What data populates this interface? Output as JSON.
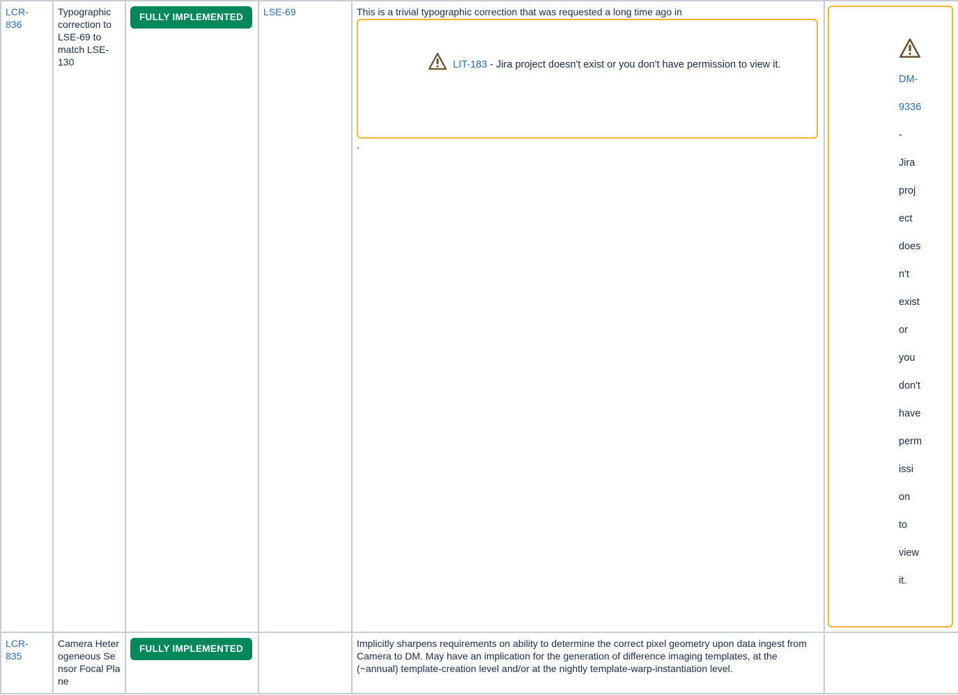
{
  "rows": [
    {
      "id": "LCR-836",
      "id_line1": "LCR-",
      "id_line2": "836",
      "title": "Typographic correction to LSE-69 to match LSE-130",
      "status": "FULLY IMPLEMENTED",
      "affected_doc": "LSE-69",
      "description_prefix": "This is a trivial typographic correction that was requested a long time ago in",
      "description_suffix": ".",
      "jira_links": [
        {
          "key": "LIT-183",
          "message": " - Jira project doesn't exist or you don't have permission to view it."
        },
        {
          "key": "DM-9336",
          "message": "- Jira project doesn't exist or you don't have permission to view it."
        }
      ]
    },
    {
      "id": "LCR-835",
      "id_line1": "LCR-",
      "id_line2": "835",
      "title": "Camera Heterogeneous Sensor Focal Plane",
      "status": "FULLY IMPLEMENTED",
      "affected_doc": "",
      "description": "Implicitly sharpens requirements on ability to determine the correct pixel geometry upon data ingest from Camera to DM. May have an implication for the generation of difference imaging templates, at the (~annual) template-creation level and/or at the nightly template-warp-instantiation level."
    }
  ],
  "colors": {
    "status_green": "#00875a",
    "link_blue": "#2b6cc4",
    "warning_border": "#f6b42a",
    "cell_border": "#c8ccd3"
  },
  "icons": {
    "warning": "warning-icon"
  }
}
